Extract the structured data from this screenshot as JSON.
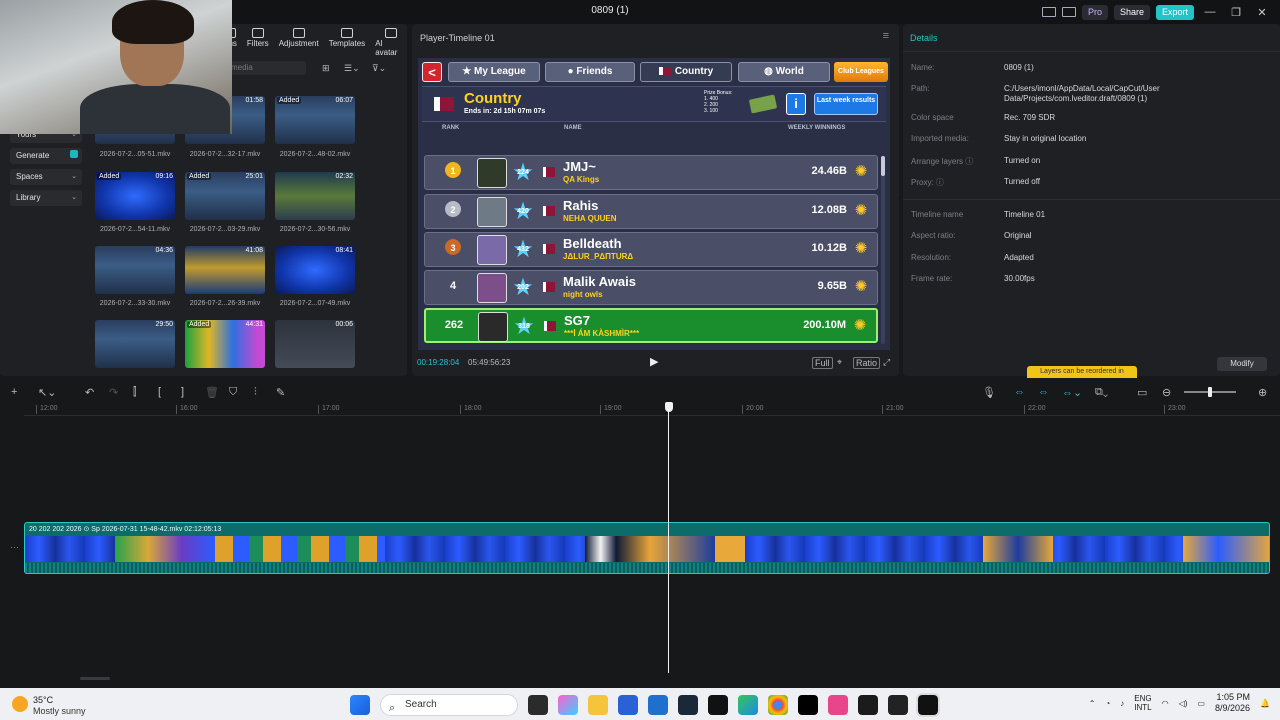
{
  "window": {
    "title": "0809 (1)",
    "pro_label": "Pro",
    "share_label": "Share",
    "export_label": "Export",
    "minimize": "—",
    "maximize": "❐",
    "close": "✕"
  },
  "toolbar": {
    "items": [
      {
        "label": "ons",
        "icon": "effects-icon"
      },
      {
        "label": "Filters",
        "icon": "filters-icon"
      },
      {
        "label": "Adjustment",
        "icon": "adjustment-icon"
      },
      {
        "label": "Templates",
        "icon": "templates-icon"
      },
      {
        "label": "AI avatar",
        "icon": "avatar-icon"
      }
    ]
  },
  "media": {
    "search_placeholder": "media",
    "sidenav": [
      {
        "label": "Yours",
        "chevron": "⌄"
      },
      {
        "label": "Generate",
        "chevron": ""
      },
      {
        "label": "Spaces",
        "chevron": "⌄"
      },
      {
        "label": "Library",
        "chevron": "⌄"
      }
    ],
    "thumbnails": [
      {
        "caption": "2026-07-2...05-51.mkv",
        "added": "",
        "duration": ""
      },
      {
        "caption": "2026-07-2...32-17.mkv",
        "added": "",
        "duration": "01:58"
      },
      {
        "caption": "2026-07-2...48-02.mkv",
        "added": "Added",
        "duration": "06:07"
      },
      {
        "caption": "2026-07-2...54-11.mkv",
        "added": "Added",
        "duration": "09:16"
      },
      {
        "caption": "2026-07-2...03-29.mkv",
        "added": "Added",
        "duration": "25:01"
      },
      {
        "caption": "2026-07-2...30-56.mkv",
        "added": "",
        "duration": "02:32"
      },
      {
        "caption": "2026-07-2...33-30.mkv",
        "added": "",
        "duration": "04:36"
      },
      {
        "caption": "2026-07-2...26-39.mkv",
        "added": "",
        "duration": "41:08"
      },
      {
        "caption": "2026-07-2...07-49.mkv",
        "added": "",
        "duration": "08:41"
      },
      {
        "caption": "",
        "added": "",
        "duration": "29:50"
      },
      {
        "caption": "",
        "added": "Added",
        "duration": "44:31"
      },
      {
        "caption": "",
        "added": "",
        "duration": "00:06"
      }
    ]
  },
  "player": {
    "title": "Player-Timeline 01",
    "current_time": "00:19:28:04",
    "total_time": "05:49:56:23",
    "play_icon": "▶",
    "ctrl_labels": [
      "Full",
      "Ratio"
    ]
  },
  "game": {
    "back": "<",
    "tabs": [
      "My League",
      "Friends",
      "Country",
      "World"
    ],
    "club_leagues": "Club Leagues",
    "league_title": "Country",
    "ends_in": "Ends in: 2d 15h 07m 07s",
    "prize_title": "Prize Bonus:",
    "prize_lines": [
      "1.    400",
      "2.    200",
      "3.    100"
    ],
    "info": "i",
    "last_week": "Last week results",
    "col_rank": "RANK",
    "col_name": "NAME",
    "col_winnings": "WEEKLY WINNINGS",
    "rows": [
      {
        "rank": "1",
        "level": "224",
        "name": "JMJ~",
        "club": "QA Kings",
        "winnings": "24.46B",
        "medal": "#f2b51d"
      },
      {
        "rank": "2",
        "level": "420",
        "name": "Rahis",
        "club": "NEHA QUUEN",
        "winnings": "12.08B",
        "medal": "#b8bcc6"
      },
      {
        "rank": "3",
        "level": "432",
        "name": "Belldeath",
        "club": "JΔLUR_PΔПТURΔ",
        "winnings": "10.12B",
        "medal": "#c86a2a"
      },
      {
        "rank": "4",
        "level": "202",
        "name": "Malik Awais",
        "club": "night owls",
        "winnings": "9.65B",
        "medal": ""
      },
      {
        "rank": "262",
        "level": "318",
        "name": "SG7",
        "club": "***İ ÁM KÀSHMÌR***",
        "winnings": "200.10M",
        "medal": ""
      }
    ]
  },
  "details": {
    "title": "Details",
    "fields": [
      {
        "k": "Name:",
        "v": "0809 (1)"
      },
      {
        "k": "Path:",
        "v": "C:/Users/imonl/AppData/Local/CapCut/User Data/Projects/com.lveditor.draft/0809 (1)"
      },
      {
        "k": "Color space",
        "v": "Rec. 709 SDR"
      },
      {
        "k": "Imported media:",
        "v": "Stay in original location"
      },
      {
        "k": "Arrange layers ⓘ",
        "v": "Turned on"
      },
      {
        "k": "Proxy: ⓘ",
        "v": "Turned off"
      },
      {
        "k": "Timeline name",
        "v": "Timeline 01"
      },
      {
        "k": "Aspect ratio:",
        "v": "Original"
      },
      {
        "k": "Resolution:",
        "v": "Adapted"
      },
      {
        "k": "Frame rate:",
        "v": "30.00fps"
      }
    ],
    "tooltip": "Layers can be reordered in",
    "modify": "Modify"
  },
  "timeline": {
    "ticks": [
      "12:00",
      "16:00",
      "17:00",
      "18:00",
      "19:00",
      "20:00",
      "21:00",
      "22:00",
      "23:00"
    ],
    "clip_labels": "20  202  202  2026  ⊙ Sp   2026-07-31 15-48-42.mkv   02:12:05:13"
  },
  "taskbar": {
    "temp": "35°C",
    "weather": "Mostly sunny",
    "search": "Search",
    "lang1": "ENG",
    "lang2": "INTL",
    "time": "1:05 PM",
    "date": "8/9/2026"
  },
  "colors": {
    "accent": "#23c4c8",
    "highlight_row": "#1a8d2d",
    "gold": "#ffd21c"
  }
}
